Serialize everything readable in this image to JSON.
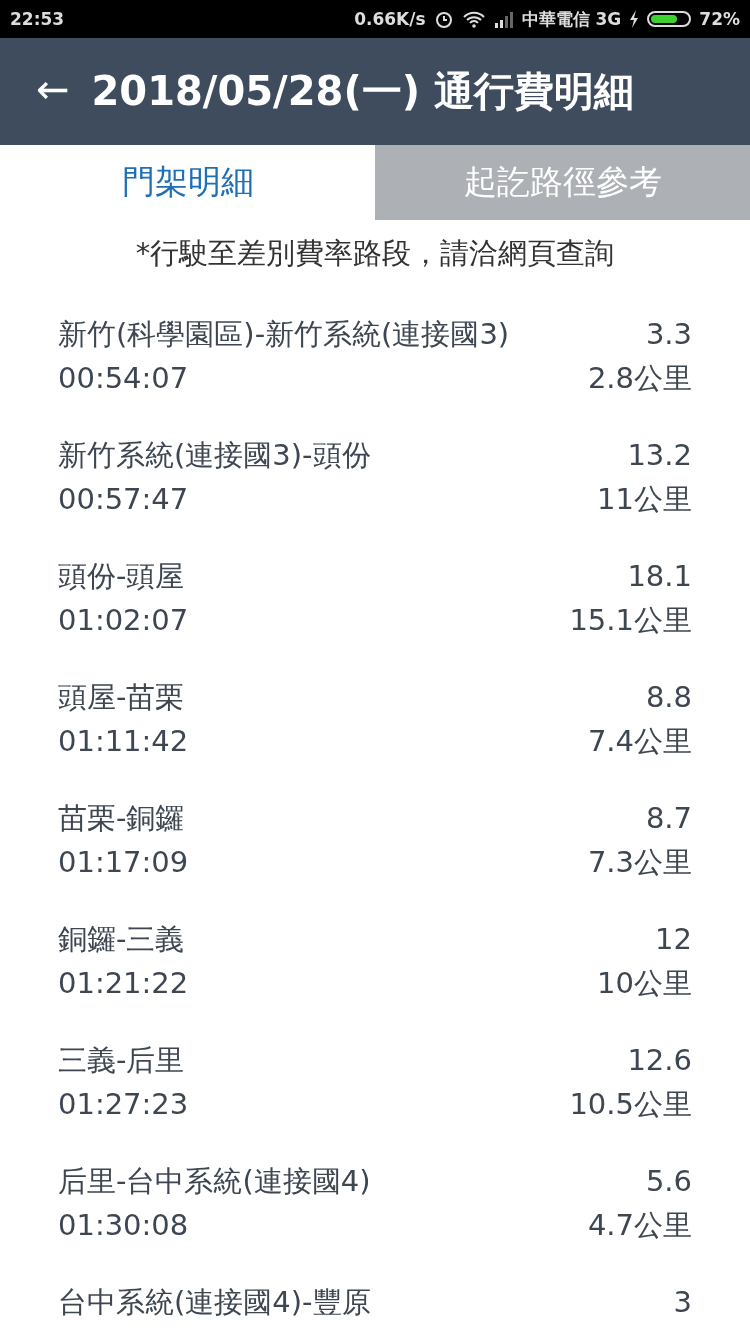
{
  "status_bar": {
    "time": "22:53",
    "speed": "0.66K/s",
    "carrier": "中華電信 3G",
    "battery": "72%"
  },
  "header": {
    "back": "←",
    "title": "2018/05/28(一) 通行費明細"
  },
  "tabs": [
    {
      "label": "門架明細",
      "selected": true
    },
    {
      "label": "起訖路徑參考",
      "selected": false
    }
  ],
  "note": "*行駛至差別費率路段，請洽網頁查詢",
  "rows": [
    {
      "segment": "新竹(科學園區)-新竹系統(連接國3)",
      "fee": "3.3",
      "time": "00:54:07",
      "distance": "2.8公里"
    },
    {
      "segment": "新竹系統(連接國3)-頭份",
      "fee": "13.2",
      "time": "00:57:47",
      "distance": "11公里"
    },
    {
      "segment": "頭份-頭屋",
      "fee": "18.1",
      "time": "01:02:07",
      "distance": "15.1公里"
    },
    {
      "segment": "頭屋-苗栗",
      "fee": "8.8",
      "time": "01:11:42",
      "distance": "7.4公里"
    },
    {
      "segment": "苗栗-銅鑼",
      "fee": "8.7",
      "time": "01:17:09",
      "distance": "7.3公里"
    },
    {
      "segment": "銅鑼-三義",
      "fee": "12",
      "time": "01:21:22",
      "distance": "10公里"
    },
    {
      "segment": "三義-后里",
      "fee": "12.6",
      "time": "01:27:23",
      "distance": "10.5公里"
    },
    {
      "segment": "后里-台中系統(連接國4)",
      "fee": "5.6",
      "time": "01:30:08",
      "distance": "4.7公里"
    },
    {
      "segment": "台中系統(連接國4)-豐原",
      "fee": "3"
    }
  ]
}
